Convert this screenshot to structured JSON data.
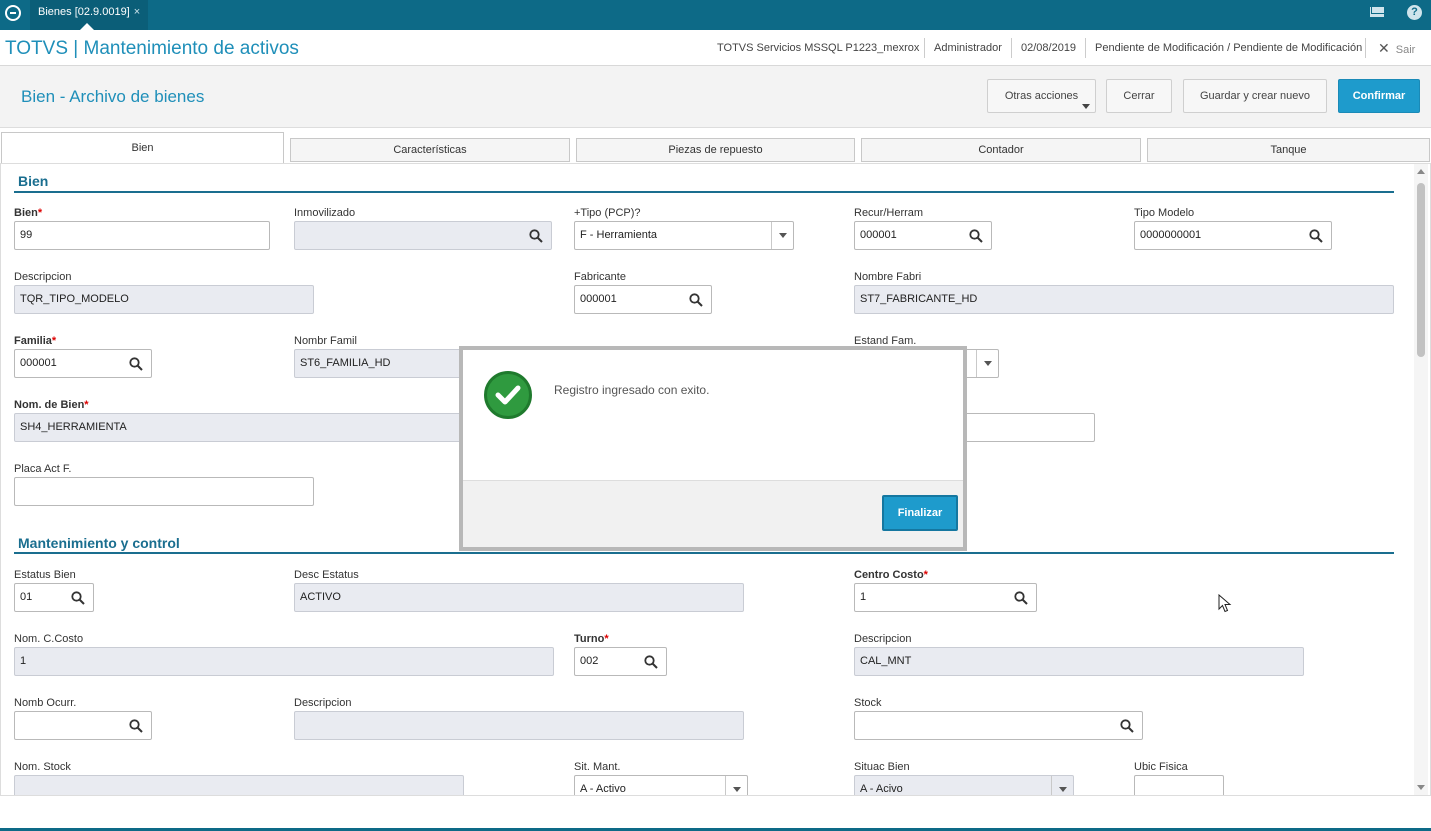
{
  "topbar": {
    "tab_label": "Bienes [02.9.0019]",
    "tab_close": "×"
  },
  "titlebar": {
    "app_title": "TOTVS | Mantenimiento de activos",
    "server": "TOTVS Servicios MSSQL P1223_mexrox",
    "user": "Administrador",
    "date": "02/08/2019",
    "status": "Pendiente de Modificación / Pendiente de Modificación",
    "exit": "Sair"
  },
  "header": {
    "page_title": "Bien - Archivo de bienes",
    "other_actions": "Otras acciones",
    "close": "Cerrar",
    "save_new": "Guardar y crear nuevo",
    "confirm": "Confirmar"
  },
  "tabs": [
    "Bien",
    "Características",
    "Piezas de repuesto",
    "Contador",
    "Tanque"
  ],
  "sections": {
    "bien": "Bien",
    "mant": "Mantenimiento y control"
  },
  "fields": {
    "bien": {
      "label": "Bien",
      "value": "99"
    },
    "inmovilizado": {
      "label": "Inmovilizado",
      "value": ""
    },
    "tipo_pcp": {
      "label": "+Tipo (PCP)?",
      "value": "F - Herramienta"
    },
    "recur_herram": {
      "label": "Recur/Herram",
      "value": "000001"
    },
    "tipo_modelo": {
      "label": "Tipo Modelo",
      "value": "0000000001"
    },
    "descripcion": {
      "label": "Descripcion",
      "value": "TQR_TIPO_MODELO"
    },
    "fabricante": {
      "label": "Fabricante",
      "value": "000001"
    },
    "nombre_fabri": {
      "label": "Nombre Fabri",
      "value": "ST7_FABRICANTE_HD"
    },
    "familia": {
      "label": "Familia",
      "value": "000001"
    },
    "nombr_famil": {
      "label": "Nombr Famil",
      "value": "ST6_FAMILIA_HD"
    },
    "estand_fam": {
      "label": "Estand Fam.",
      "value": ""
    },
    "nom_bien": {
      "label": "Nom. de Bien",
      "value": "SH4_HERRAMIENTA"
    },
    "placa_act": {
      "label": "Placa Act F.",
      "value": ""
    },
    "estatus_bien": {
      "label": "Estatus Bien",
      "value": "01"
    },
    "desc_estatus": {
      "label": "Desc Estatus",
      "value": "ACTIVO"
    },
    "centro_costo": {
      "label": "Centro Costo",
      "value": "1"
    },
    "nom_ccosto": {
      "label": "Nom. C.Costo",
      "value": "1"
    },
    "turno": {
      "label": "Turno",
      "value": "002"
    },
    "descripcion2": {
      "label": "Descripcion",
      "value": "CAL_MNT"
    },
    "nomb_ocurr": {
      "label": "Nomb Ocurr.",
      "value": ""
    },
    "descripcion3": {
      "label": "Descripcion",
      "value": ""
    },
    "stock": {
      "label": "Stock",
      "value": ""
    },
    "nom_stock": {
      "label": "Nom. Stock",
      "value": ""
    },
    "sit_mant": {
      "label": "Sit. Mant.",
      "value": "A - Activo"
    },
    "situac_bien": {
      "label": "Situac Bien",
      "value": "A - Acivo"
    },
    "ubic_fisica": {
      "label": "Ubic Fisica",
      "value": ""
    }
  },
  "modal": {
    "message": "Registro ingresado con exito.",
    "finish": "Finalizar"
  },
  "colors": {
    "brand": "#0d6a87",
    "accent": "#1e9bcc",
    "success": "#2f9a3f"
  }
}
